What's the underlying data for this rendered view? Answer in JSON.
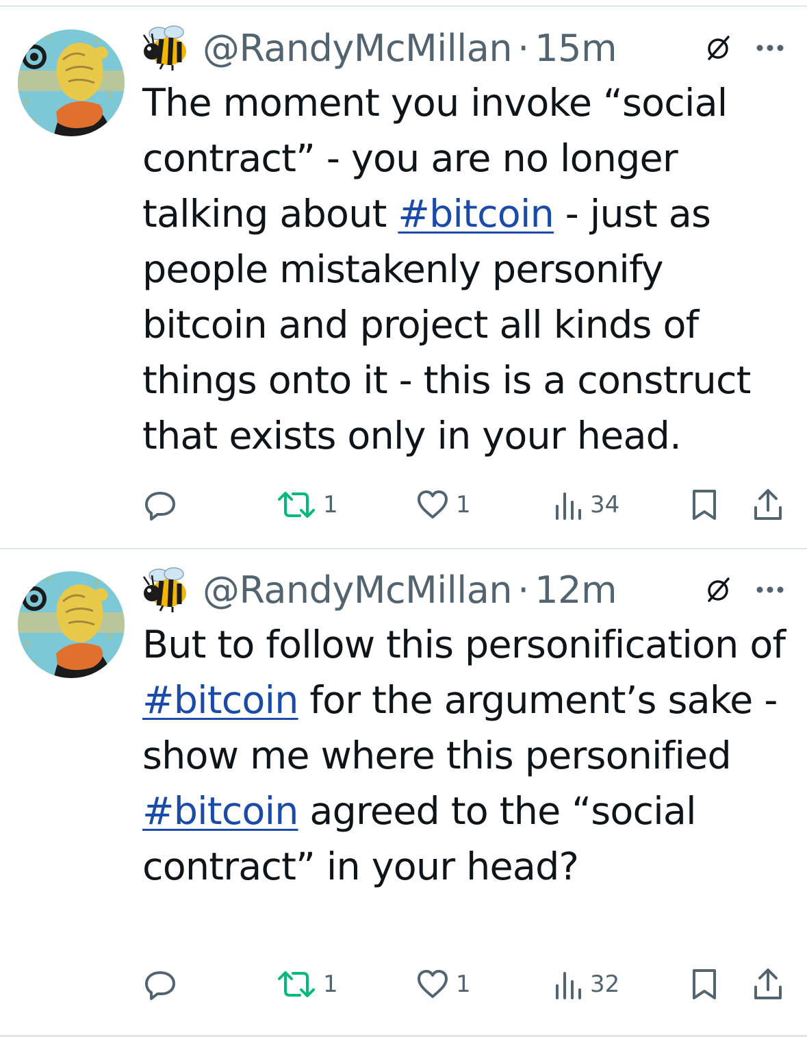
{
  "tweets": [
    {
      "handle": "@RandyMcMillan",
      "separator": "·",
      "time": "15m",
      "text_parts": [
        {
          "type": "text",
          "value": "The moment you invoke “social contract” - you are no longer talking about "
        },
        {
          "type": "hashtag",
          "value": "#bitcoin"
        },
        {
          "type": "text",
          "value": " - just as people mistakenly personify bitcoin and project all kinds of things onto it - this is a construct that exists only in your head."
        }
      ],
      "actions": {
        "reply_count": "",
        "retweet_count": "1",
        "like_count": "1",
        "views_count": "34"
      }
    },
    {
      "handle": "@RandyMcMillan",
      "separator": "·",
      "time": "12m",
      "text_parts": [
        {
          "type": "text",
          "value": "But to follow this personification of "
        },
        {
          "type": "hashtag",
          "value": "#bitcoin"
        },
        {
          "type": "text",
          "value": " for the argument’s sake - show me where this personified "
        },
        {
          "type": "hashtag",
          "value": "#bitcoin"
        },
        {
          "type": "text",
          "value": " agreed to the “social contract” in your head?"
        }
      ],
      "actions": {
        "reply_count": "",
        "retweet_count": "1",
        "like_count": "1",
        "views_count": "32"
      }
    }
  ],
  "icons": {
    "avatar": "avatar-image",
    "badge": "bee-icon",
    "grok": "grok-icon",
    "more": "more-icon",
    "reply": "reply-icon",
    "retweet": "retweet-icon",
    "like": "heart-icon",
    "views": "views-icon",
    "bookmark": "bookmark-icon",
    "share": "share-icon"
  },
  "colors": {
    "text": "#0f1419",
    "secondary": "#536471",
    "hashtag": "#1a4ba8",
    "retweet": "#00ba7c",
    "divider": "#dfe4e8"
  }
}
